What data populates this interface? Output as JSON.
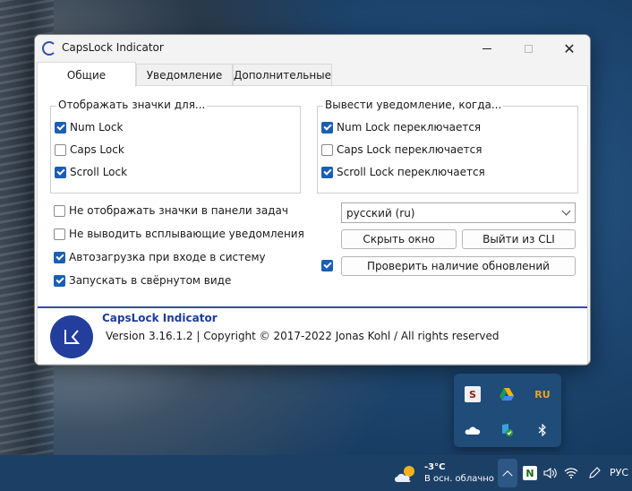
{
  "window": {
    "title": "CapsLock Indicator"
  },
  "tabs": [
    {
      "label": "Общие",
      "active": true
    },
    {
      "label": "Уведомление",
      "active": false
    },
    {
      "label": "Дополнительные",
      "active": false
    }
  ],
  "group_show_icons": {
    "legend": "Отображать значки для...",
    "items": [
      {
        "label": "Num Lock",
        "checked": true
      },
      {
        "label": "Caps Lock",
        "checked": false
      },
      {
        "label": "Scroll Lock",
        "checked": true
      }
    ]
  },
  "group_notify": {
    "legend": "Вывести уведомление, когда...",
    "items": [
      {
        "label": "Num Lock переключается",
        "checked": true
      },
      {
        "label": "Caps Lock переключается",
        "checked": false
      },
      {
        "label": "Scroll Lock переключается",
        "checked": true
      }
    ]
  },
  "options": [
    {
      "label": "Не отображать значки в панели задач",
      "checked": false
    },
    {
      "label": "Не выводить всплывающие уведомления",
      "checked": false
    },
    {
      "label": "Автозагрузка при входе в систему",
      "checked": true
    },
    {
      "label": "Запускать в свёрнутом виде",
      "checked": true
    }
  ],
  "language_select": {
    "value": "русский (ru)"
  },
  "buttons": {
    "hide": "Скрыть окно",
    "exit": "Выйти из CLI",
    "check_updates": "Проверить наличие обновлений"
  },
  "update_checkbox_checked": true,
  "footer": {
    "name": "CapsLock Indicator",
    "version": "Version 3.16.1.2 | Copyright © 2017-2022 Jonas Kohl / All rights reserved"
  },
  "tray_flyout": {
    "icons": [
      {
        "name": "s-app-icon",
        "text": "S"
      },
      {
        "name": "google-drive-icon",
        "text": ""
      },
      {
        "name": "ru-language-icon",
        "text": "RU"
      },
      {
        "name": "onedrive-cloud-icon",
        "text": ""
      },
      {
        "name": "defender-shield-icon",
        "text": ""
      },
      {
        "name": "bluetooth-icon",
        "text": ""
      }
    ]
  },
  "taskbar": {
    "weather_temp": "-3°C",
    "weather_desc": "В осн. облачно",
    "notion_icon": "N",
    "language": "РУС"
  }
}
